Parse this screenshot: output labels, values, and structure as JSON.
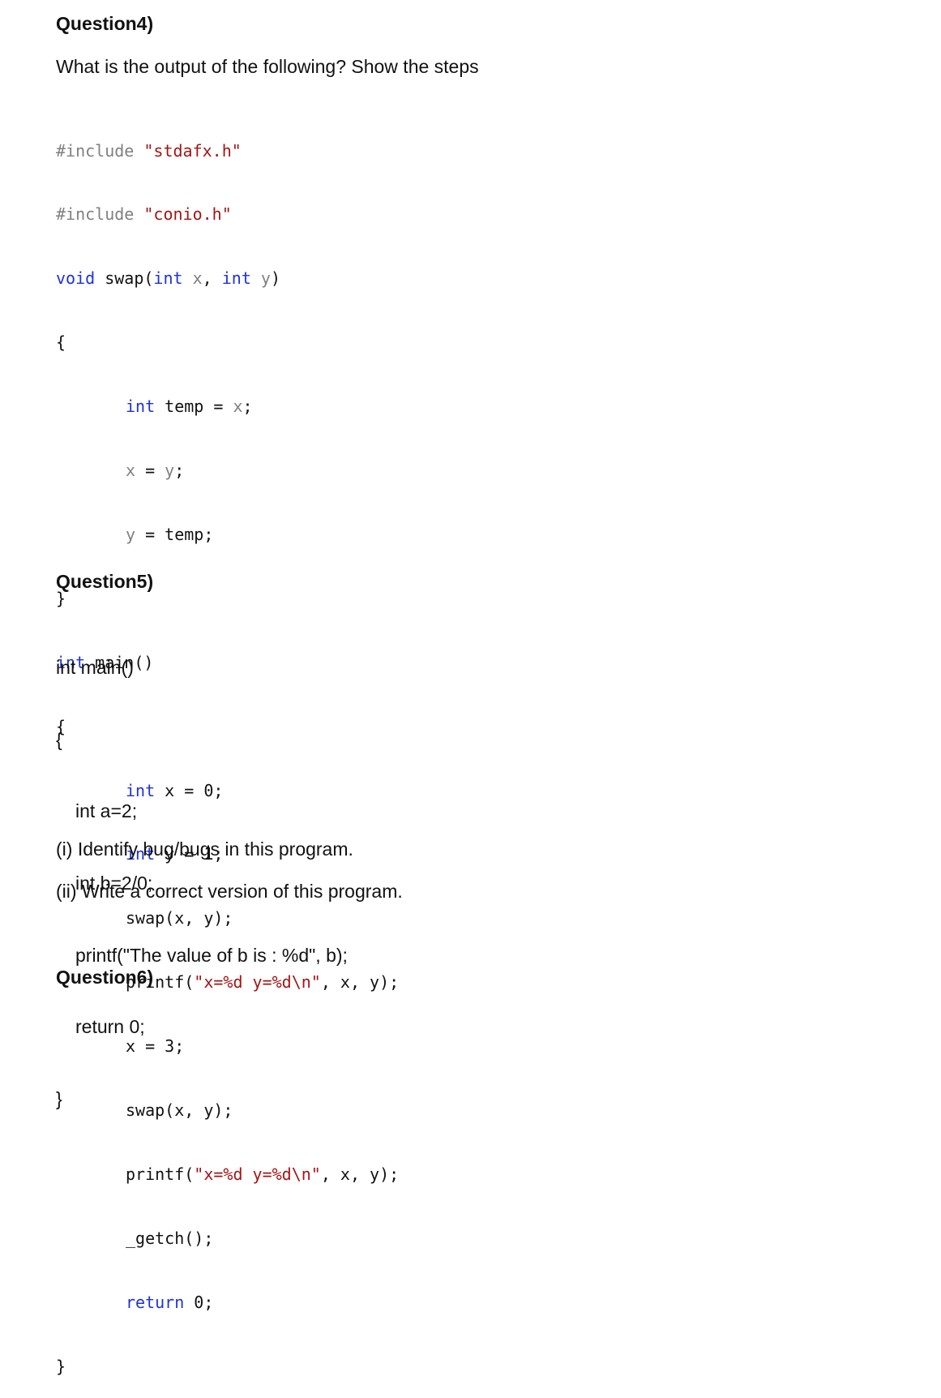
{
  "question4": {
    "heading": "Question4)",
    "prompt": "What is the output of the following? Show the steps",
    "code": {
      "include1_directive": "#include ",
      "include1_file": "\"stdafx.h\"",
      "include2_directive": "#include ",
      "include2_file": "\"conio.h\"",
      "swap_sig": {
        "kw_void": "void",
        "name": " swap(",
        "kw_int1": "int",
        "p1": " x",
        "comma": ", ",
        "kw_int2": "int",
        "p2": " y",
        "close": ")"
      },
      "open_brace1": "{",
      "swap_body": [
        {
          "kw": "int",
          "rest1": " temp = ",
          "param": "x",
          "rest2": ";"
        },
        {
          "param1": "x",
          "mid": " = ",
          "param2": "y",
          "end": ";"
        },
        {
          "param1": "y",
          "mid": " = temp;"
        }
      ],
      "close_brace1": "}",
      "main_sig": {
        "kw": "int",
        "rest": " main()"
      },
      "open_brace2": "{",
      "main_body": {
        "line1": {
          "kw": "int",
          "rest": " x = 0;"
        },
        "line2": {
          "kw": "int",
          "rest": " y = 1;"
        },
        "line3": "swap(x, y);",
        "line4": {
          "pre": "printf(",
          "str": "\"x=%d y=%d\\n\"",
          "post": ", x, y);"
        },
        "line5": "x = 3;",
        "line6": "swap(x, y);",
        "line7": {
          "pre": "printf(",
          "str": "\"x=%d y=%d\\n\"",
          "post": ", x, y);"
        },
        "line8": "_getch();",
        "line9": {
          "kw": "return",
          "rest": " 0;"
        }
      },
      "close_brace2": "}"
    }
  },
  "question5": {
    "heading": "Question5)",
    "code_lines": [
      "int main()",
      "{",
      "int a=2;",
      "int b=2/0;",
      "printf(\"The value of b is : %d\", b);",
      "return 0;",
      "}"
    ],
    "tasks": [
      "(i) Identify bug/bugs in this program.",
      "(ii) Write a correct version of this program."
    ]
  },
  "question6": {
    "heading": "Question6)"
  },
  "colors": {
    "keyword": "#1e32d8",
    "string": "#a31515",
    "preprocessor": "#808080",
    "text": "#111111"
  }
}
